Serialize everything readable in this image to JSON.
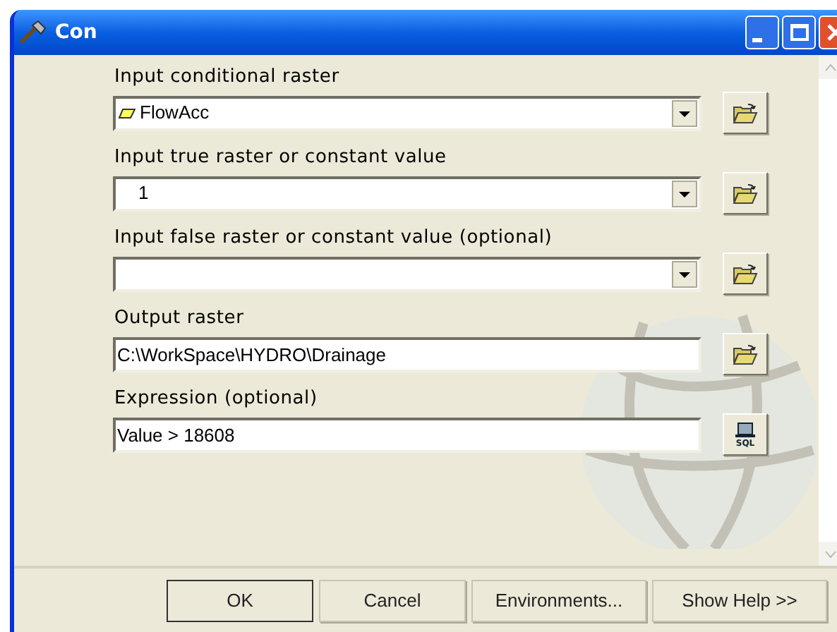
{
  "window": {
    "title": "Con"
  },
  "fields": [
    {
      "label": "Input conditional raster",
      "kind": "dropdown",
      "value": "FlowAcc",
      "layer_icon": true,
      "button": {
        "kind": "browse"
      }
    },
    {
      "label": "Input true raster or constant value",
      "kind": "dropdown",
      "value": "1",
      "layer_icon": false,
      "button": {
        "kind": "browse"
      }
    },
    {
      "label": "Input false raster or constant value (optional)",
      "kind": "dropdown",
      "layer_icon": false,
      "button": {
        "kind": "browse"
      }
    },
    {
      "label": "Output raster",
      "kind": "text",
      "value": "C:\\WorkSpace\\HYDRO\\Drainage",
      "layer_icon": false,
      "button": {
        "kind": "browse"
      }
    },
    {
      "label": "Expression (optional)",
      "kind": "text",
      "value": "Value > 18608",
      "layer_icon": false,
      "button": {
        "kind": "query",
        "text": "SQL"
      }
    }
  ],
  "buttons": [
    {
      "label": "OK",
      "default": true
    },
    {
      "label": "Cancel",
      "default": false
    },
    {
      "label": "Environments...",
      "default": false
    },
    {
      "label": "Show Help >>",
      "default": false
    }
  ]
}
